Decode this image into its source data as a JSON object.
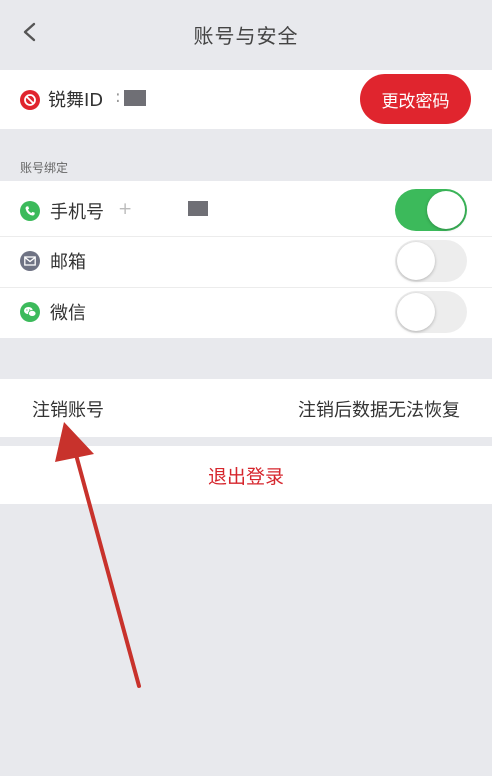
{
  "header": {
    "title": "账号与安全",
    "back_icon": "chevron-left-icon"
  },
  "account": {
    "id_label": "锐舞ID",
    "id_value_visible": ":",
    "change_password_label": "更改密码",
    "icon": "ban-icon",
    "icon_color": "#e0252e"
  },
  "binding": {
    "section_label": "账号绑定",
    "items": [
      {
        "label": "手机号",
        "partial_value": "+",
        "icon": "phone-icon",
        "icon_color": "#3cba5b",
        "toggle_on": true
      },
      {
        "label": "邮箱",
        "icon": "mail-icon",
        "icon_color": "#6f7384",
        "toggle_on": false
      },
      {
        "label": "微信",
        "icon": "wechat-icon",
        "icon_color": "#3cba5b",
        "toggle_on": false
      }
    ]
  },
  "cancel_account": {
    "label": "注销账号",
    "hint": "注销后数据无法恢复"
  },
  "logout": {
    "label": "退出登录"
  },
  "colors": {
    "accent": "#e0252e",
    "toggle_on": "#3cba5b",
    "background": "#e8e9ed",
    "annotation_arrow": "#c8322c"
  }
}
